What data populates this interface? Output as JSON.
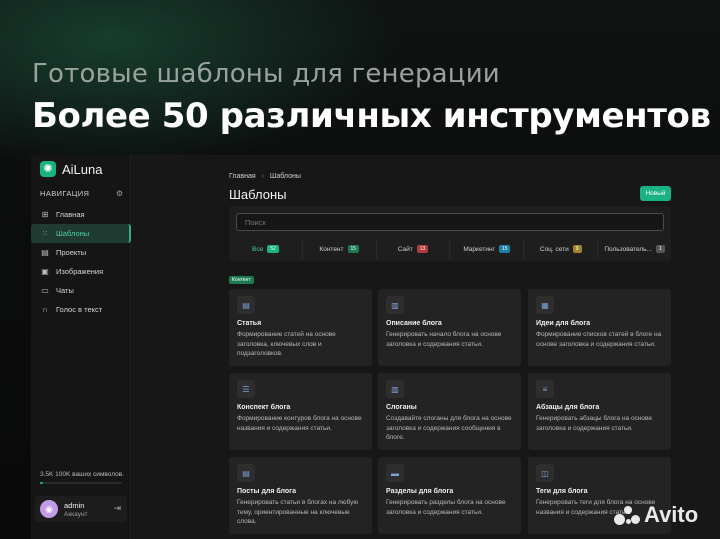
{
  "hero": {
    "subtitle": "Готовые шаблоны для генерации",
    "title": "Более 50 различных инструментов"
  },
  "brand": {
    "name": "AiLuna",
    "logo_icon": "openai-icon"
  },
  "nav": {
    "header": "НАВИГАЦИЯ",
    "items": [
      {
        "label": "Главная",
        "icon": "grid-icon"
      },
      {
        "label": "Шаблоны",
        "icon": "apps-icon",
        "active": true
      },
      {
        "label": "Проекты",
        "icon": "folder-icon"
      },
      {
        "label": "Изображения",
        "icon": "image-icon"
      },
      {
        "label": "Чаты",
        "icon": "chat-icon"
      },
      {
        "label": "Голос в текст",
        "icon": "headphones-icon"
      }
    ]
  },
  "usage": {
    "text": "3.5K 100K ваших символов.",
    "fraction": 0.035
  },
  "user": {
    "name": "admin",
    "role": "Аккаунт",
    "avatar_glyph": "◉"
  },
  "breadcrumb": {
    "home": "Главная",
    "current": "Шаблоны"
  },
  "page": {
    "title": "Шаблоны",
    "new_button": "Новый"
  },
  "search": {
    "placeholder": "Поиск"
  },
  "tabs": [
    {
      "label": "Все",
      "count": "52",
      "color": "#19b383",
      "active": true
    },
    {
      "label": "Контент",
      "count": "15",
      "color": "#1c7a52"
    },
    {
      "label": "Сайт",
      "count": "13",
      "color": "#b23a3a"
    },
    {
      "label": "Маркетинг",
      "count": "15",
      "color": "#1d7fa6"
    },
    {
      "label": "Соц. сети",
      "count": "9",
      "color": "#a0862a"
    },
    {
      "label": "Пользователь...",
      "count": "1",
      "color": "#555555"
    }
  ],
  "section_badge": "Контент",
  "cards": [
    {
      "title": "Статья",
      "desc": "Формирование статей на основе заголовка, ключевых слов и подзаголовков.",
      "icon": "document-icon"
    },
    {
      "title": "Описание блога",
      "desc": "Генерировать начало блога на основе заголовка и содержания статьи.",
      "icon": "article-icon"
    },
    {
      "title": "Идеи для блога",
      "desc": "Формирование списков статей в блоге на основе заголовка и содержания статьи.",
      "icon": "ideas-icon"
    },
    {
      "title": "Конспект блога",
      "desc": "Формирование контуров блога на основе названия и содержания статьи.",
      "icon": "list-icon"
    },
    {
      "title": "Слоганы",
      "desc": "Создавайте слоганы для блога на основе заголовка и содержания сообщения в блоге.",
      "icon": "article-icon"
    },
    {
      "title": "Абзацы для блога",
      "desc": "Генерировать абзацы блога на основе заголовка и содержания статьи.",
      "icon": "paragraph-icon"
    },
    {
      "title": "Посты для блога",
      "desc": "Генерировать статьи в блогах на любую тему, ориентированные на ключевые слова.",
      "icon": "document-icon"
    },
    {
      "title": "Разделы для блога",
      "desc": "Генерировать разделы блога на основе заголовка и содержания статьи.",
      "icon": "sections-icon"
    },
    {
      "title": "Теги для блога",
      "desc": "Генерировать теги для блога на основе названия и содержания статьи.",
      "icon": "tag-icon"
    }
  ],
  "watermark": {
    "text": "Avito"
  }
}
